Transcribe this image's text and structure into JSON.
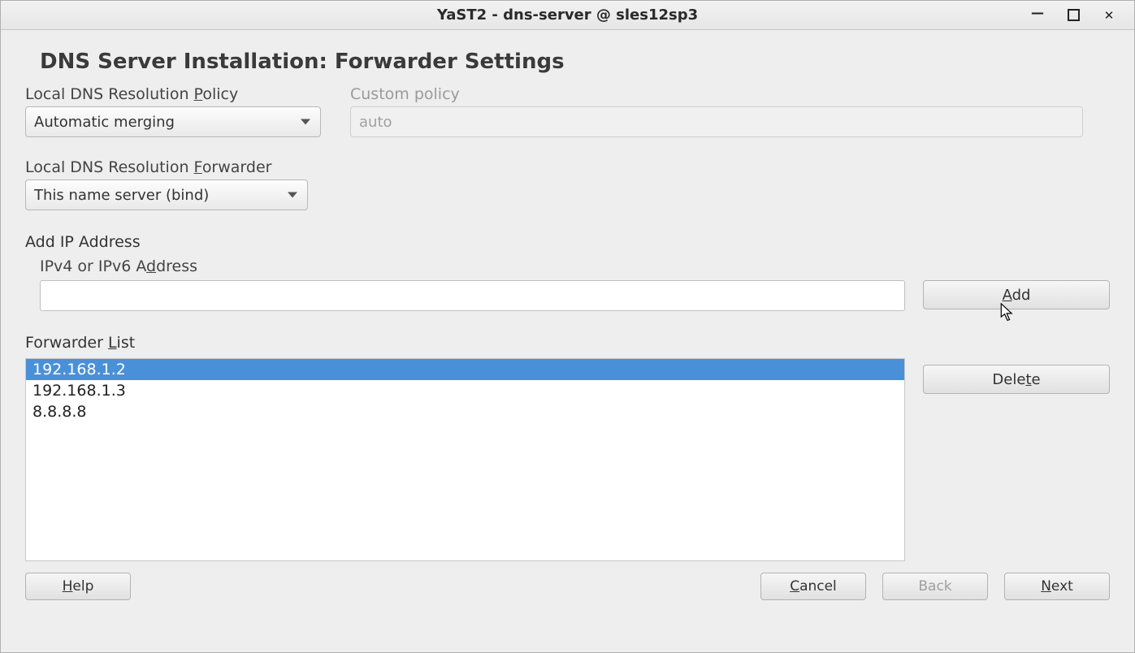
{
  "window": {
    "title": "YaST2 - dns-server @ sles12sp3"
  },
  "page": {
    "title": "DNS Server Installation: Forwarder Settings"
  },
  "policy": {
    "label_pre": "Local DNS Resolution ",
    "label_access": "P",
    "label_post": "olicy",
    "value": "Automatic merging"
  },
  "custom_policy": {
    "label": "Custom policy",
    "value": "auto"
  },
  "forwarder": {
    "label_pre": "Local DNS Resolution ",
    "label_access": "F",
    "label_post": "orwarder",
    "value": "This name server (bind)"
  },
  "add_ip": {
    "section_label": "Add IP Address",
    "field_label_pre": "IPv4 or IPv6 A",
    "field_label_access": "d",
    "field_label_post": "dress",
    "value": "",
    "button_access": "A",
    "button_post": "dd"
  },
  "flist": {
    "label_pre": "Forwarder ",
    "label_access": "L",
    "label_post": "ist",
    "items": [
      "192.168.1.2",
      "192.168.1.3",
      "8.8.8.8"
    ],
    "selected_index": 0,
    "delete_pre": "Dele",
    "delete_access": "t",
    "delete_post": "e"
  },
  "buttons": {
    "help_access": "H",
    "help_post": "elp",
    "cancel_access": "C",
    "cancel_post": "ancel",
    "back_label": "Back",
    "next_access": "N",
    "next_post": "ext"
  }
}
